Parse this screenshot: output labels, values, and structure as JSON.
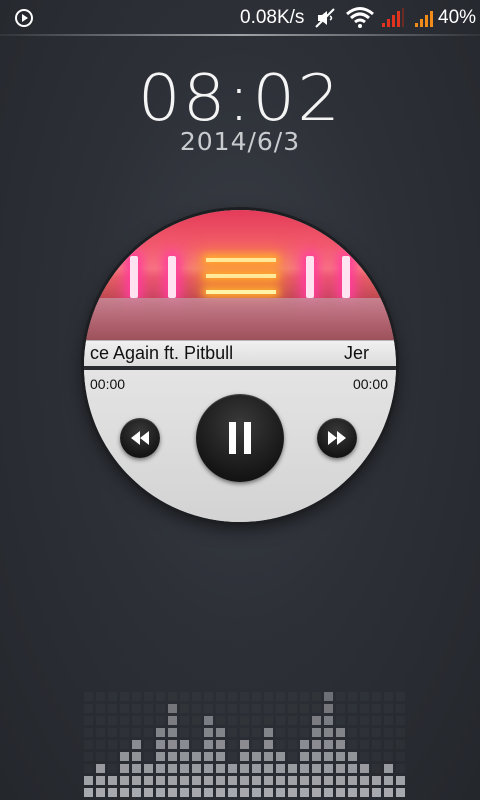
{
  "status_bar": {
    "net_speed": "0.08K/s",
    "battery_percent": "40%",
    "icons": [
      "play-notification-icon",
      "mute-icon",
      "wifi-icon",
      "cell-signal-icon",
      "cell-signal-2-icon"
    ],
    "signal_color": "#e0341e",
    "battery_signal_color": "#f08c1a"
  },
  "lockscreen": {
    "time": "08:02",
    "date": "2014/6/3"
  },
  "player": {
    "track_title": "ce Again ft. Pitbull",
    "track_artist": "Jer",
    "time_elapsed": "00:00",
    "time_total": "00:00",
    "progress": 0,
    "controls": {
      "rewind_icon": "rewind-icon",
      "pause_icon": "pause-icon",
      "forward_icon": "fast-forward-icon"
    }
  },
  "colors": {
    "background": "#2d3037",
    "disc": "#d7d7d7",
    "button": "#161616"
  }
}
